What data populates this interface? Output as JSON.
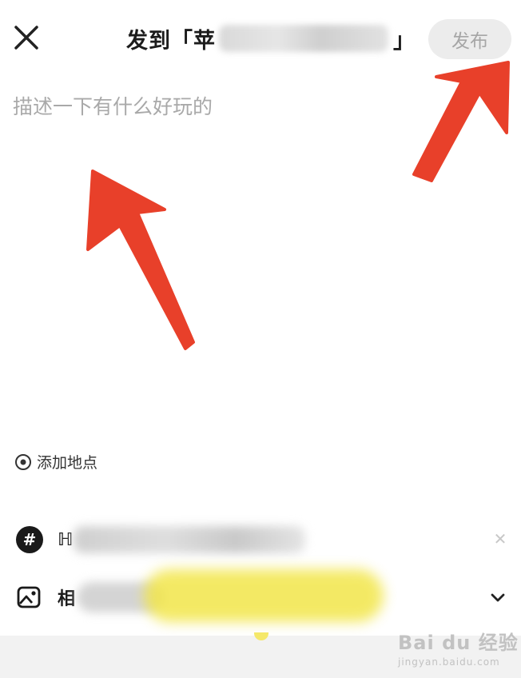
{
  "header": {
    "title_prefix": "发到「苹",
    "title_suffix": "」",
    "publish_label": "发布"
  },
  "editor": {
    "placeholder": "描述一下有什么好玩的"
  },
  "location": {
    "label": "添加地点"
  },
  "topic_row": {
    "label_visible": "ℍ"
  },
  "album_row": {
    "label_visible": "相"
  },
  "watermark": {
    "brand": "Bai du 经验",
    "url": "jingyan.baidu.com"
  },
  "colors": {
    "annotation_arrow": "#e8402a",
    "publish_bg": "#ececec",
    "publish_text": "#a6a6a6",
    "placeholder": "#a9a9a9"
  },
  "icons": [
    "close-icon",
    "location-pin-icon",
    "hash-icon",
    "album-icon",
    "chevron-down-icon"
  ]
}
